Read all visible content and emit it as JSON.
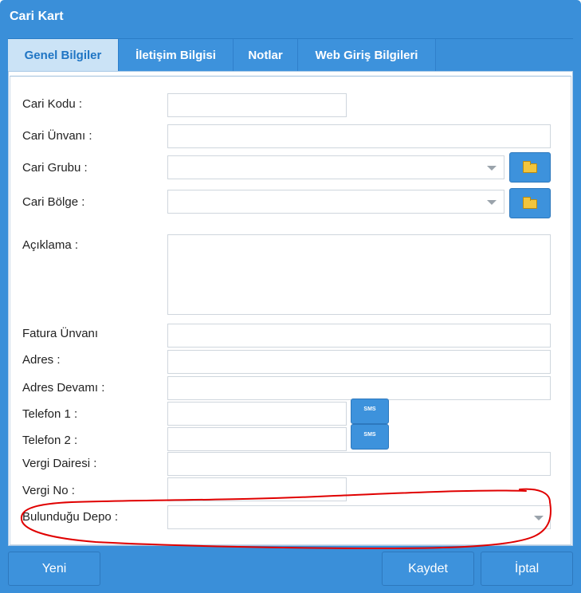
{
  "window": {
    "title": "Cari Kart"
  },
  "tabs": [
    {
      "label": "Genel Bilgiler",
      "active": true
    },
    {
      "label": "İletişim Bilgisi",
      "active": false
    },
    {
      "label": "Notlar",
      "active": false
    },
    {
      "label": "Web Giriş Bilgileri",
      "active": false
    }
  ],
  "form": {
    "cari_kodu": {
      "label": "Cari Kodu :",
      "value": ""
    },
    "cari_unvani": {
      "label": "Cari Ünvanı :",
      "value": ""
    },
    "cari_grubu": {
      "label": "Cari Grubu :",
      "value": ""
    },
    "cari_bolge": {
      "label": "Cari Bölge :",
      "value": ""
    },
    "aciklama": {
      "label": "Açıklama :",
      "value": ""
    },
    "fatura_unvani": {
      "label": "Fatura Ünvanı",
      "value": ""
    },
    "adres": {
      "label": "Adres :",
      "value": ""
    },
    "adres_devami": {
      "label": "Adres Devamı :",
      "value": ""
    },
    "telefon1": {
      "label": "Telefon 1 :",
      "value": ""
    },
    "telefon2": {
      "label": "Telefon 2 :",
      "value": ""
    },
    "vergi_dairesi": {
      "label": "Vergi Dairesi :",
      "value": ""
    },
    "vergi_no": {
      "label": "Vergi No :",
      "value": ""
    },
    "bulundugu_depo": {
      "label": "Bulunduğu Depo :",
      "value": ""
    }
  },
  "sms_label": "SMS",
  "buttons": {
    "yeni": "Yeni",
    "kaydet": "Kaydet",
    "iptal": "İptal"
  },
  "icons": {
    "folder": "folder-icon",
    "dropdown": "chevron-down-icon"
  },
  "colors": {
    "accent": "#3a8fd9",
    "annotation": "#e00000",
    "folder": "#f2c53d"
  }
}
